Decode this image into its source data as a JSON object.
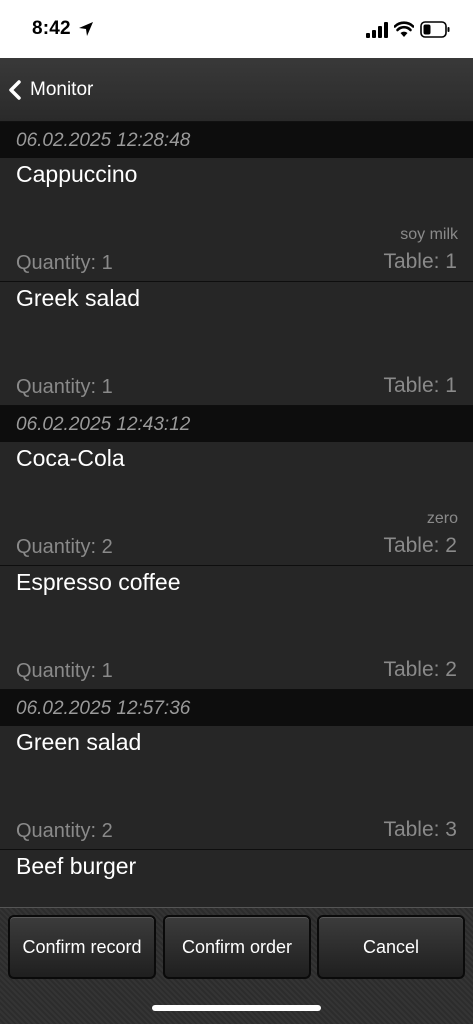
{
  "status": {
    "time": "8:42"
  },
  "nav": {
    "back_label": "Monitor"
  },
  "groups": [
    {
      "timestamp": "06.02.2025 12:28:48",
      "items": [
        {
          "name": "Cappuccino",
          "note": "soy milk",
          "quantity": "Quantity: 1",
          "table": "Table: 1"
        },
        {
          "name": "Greek salad",
          "note": "",
          "quantity": "Quantity: 1",
          "table": "Table: 1"
        }
      ]
    },
    {
      "timestamp": "06.02.2025 12:43:12",
      "items": [
        {
          "name": "Coca-Cola",
          "note": "zero",
          "quantity": "Quantity: 2",
          "table": "Table: 2"
        },
        {
          "name": "Espresso coffee",
          "note": "",
          "quantity": "Quantity: 1",
          "table": "Table: 2"
        }
      ]
    },
    {
      "timestamp": "06.02.2025 12:57:36",
      "items": [
        {
          "name": "Green salad",
          "note": "",
          "quantity": "Quantity: 2",
          "table": "Table: 3"
        },
        {
          "name": "Beef burger",
          "note": "",
          "quantity": "",
          "table": ""
        }
      ]
    }
  ],
  "toolbar": {
    "confirm_record": "Confirm record",
    "confirm_order": "Confirm order",
    "cancel": "Cancel"
  }
}
